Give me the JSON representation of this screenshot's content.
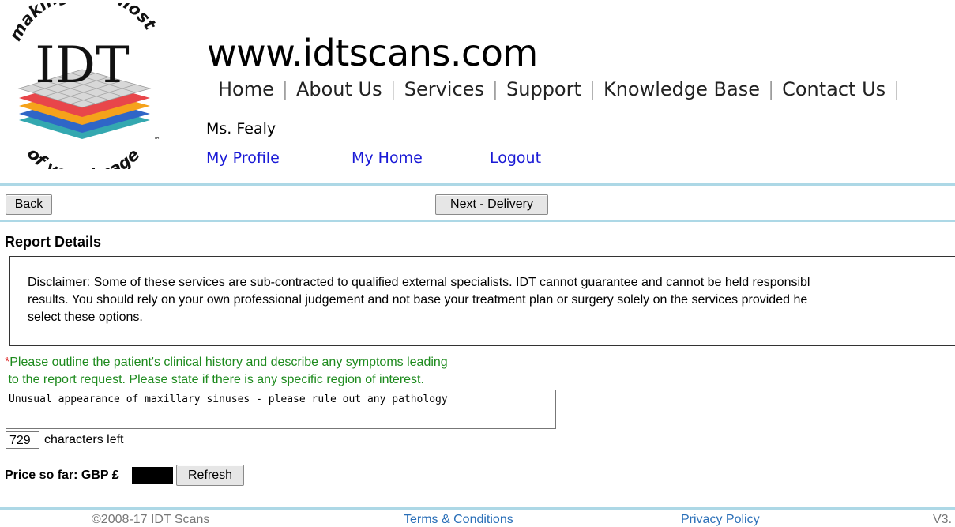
{
  "site": {
    "title": "www.idtscans.com",
    "logo": {
      "top_text": "making the most",
      "main_text": "IDT",
      "bottom_text": "of your image",
      "trademark": "™",
      "colors": {
        "grid_top": "#bdbdbd",
        "grid_red": "#e8464a",
        "grid_orange": "#f5a21b",
        "grid_blue": "#2f66c7",
        "grid_teal": "#34a8b0"
      }
    }
  },
  "nav": {
    "items": [
      "Home",
      "About Us",
      "Services",
      "Support",
      "Knowledge Base",
      "Contact Us"
    ],
    "separator": "|"
  },
  "user": {
    "name": "Ms. Fealy",
    "links": [
      "My Profile",
      "My Home",
      "Logout"
    ]
  },
  "toolbar": {
    "back_label": "Back",
    "next_label": "Next - Delivery"
  },
  "report": {
    "section_title": "Report Details",
    "disclaimer_lines": [
      "Disclaimer: Some of these services are sub-contracted to qualified external specialists. IDT cannot guarantee and cannot be held responsibl",
      "results. You should rely on your own professional judgement and not base your treatment plan or surgery solely on the services provided he",
      "select these options."
    ],
    "required_marker": "*",
    "prompt_line1": "Please outline the patient's clinical history and describe any symptoms leading",
    "prompt_line2": " to the report request. Please state if there is any specific region of interest.",
    "history_value": "Unusual appearance of maxillary sinuses - please rule out any pathology",
    "characters_left_value": "729",
    "characters_left_label": "characters left"
  },
  "price": {
    "label": "Price so far: GBP £",
    "refresh_label": "Refresh"
  },
  "footer": {
    "copyright": "©2008-17 IDT Scans",
    "terms": "Terms & Conditions",
    "privacy": "Privacy Policy",
    "version": "V3."
  },
  "colors": {
    "rule": "#add8e6",
    "link": "#1a1ad6",
    "prompt_green": "#1d8a1d",
    "required_red": "#d22222",
    "footer_link": "#2a6fb8",
    "footer_grey": "#777777"
  }
}
